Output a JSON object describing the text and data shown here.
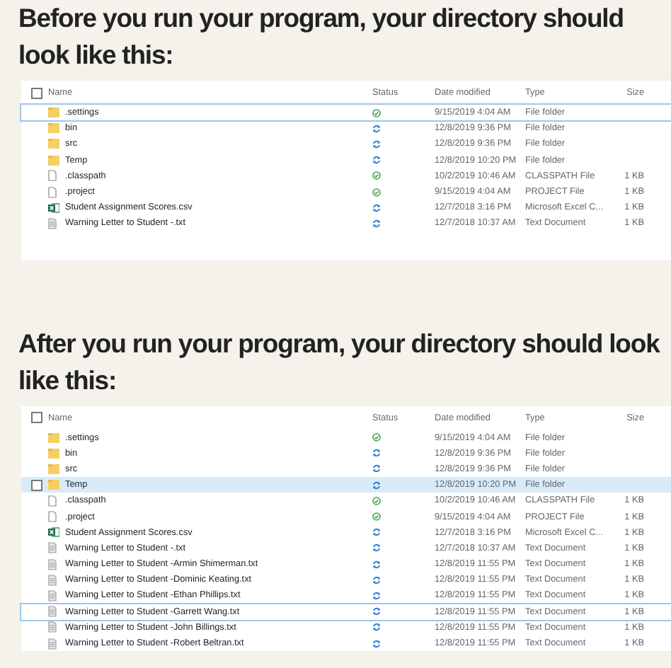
{
  "sections": [
    {
      "heading": "Before you run your program, your directory should look like this:",
      "explorer": {
        "select_all_checked": false,
        "columns": [
          "Name",
          "Status",
          "Date modified",
          "Type",
          "Size"
        ],
        "rows": [
          {
            "name": ".settings",
            "kind": "folder",
            "synced": true,
            "date": "9/15/2019 4:04 AM",
            "type": "File folder",
            "selected": false,
            "focused": true
          },
          {
            "name": "bin",
            "kind": "folder",
            "synced": false,
            "date": "12/8/2019 9:36 PM",
            "type": "File folder",
            "selected": false,
            "focused": false
          },
          {
            "name": "src",
            "kind": "folder",
            "synced": false,
            "date": "12/8/2019 9:36 PM",
            "type": "File folder",
            "selected": false,
            "focused": false
          },
          {
            "name": "Temp",
            "kind": "folder",
            "synced": false,
            "date": "12/8/2019 10:20 PM",
            "type": "File folder",
            "selected": false,
            "focused": false
          },
          {
            "name": ".classpath",
            "kind": "file",
            "synced": true,
            "date": "10/2/2019 10:46 AM",
            "type": "CLASSPATH File",
            "size": "1 KB",
            "selected": false,
            "focused": false
          },
          {
            "name": ".project",
            "kind": "file",
            "synced": true,
            "date": "9/15/2019 4:04 AM",
            "type": "PROJECT File",
            "size": "1 KB",
            "selected": false,
            "focused": false
          },
          {
            "name": "Student Assignment Scores.csv",
            "kind": "spreadsheet",
            "synced": false,
            "date": "12/7/2018 3:16 PM",
            "type": "Microsoft Excel C...",
            "size": "1 KB",
            "selected": false,
            "focused": false
          },
          {
            "name": "Warning Letter to Student -.txt",
            "kind": "text",
            "synced": false,
            "date": "12/7/2018 10:37 AM",
            "type": "Text Document",
            "size": "1 KB",
            "selected": false,
            "focused": false
          }
        ]
      }
    },
    {
      "heading": "After you run your program, your directory should look like this:",
      "explorer": {
        "select_all_checked": false,
        "columns": [
          "Name",
          "Status",
          "Date modified",
          "Type",
          "Size"
        ],
        "rows": [
          {
            "name": ".settings",
            "kind": "folder",
            "synced": true,
            "date": "9/15/2019 4:04 AM",
            "type": "File folder",
            "selected": false,
            "focused": false
          },
          {
            "name": "bin",
            "kind": "folder",
            "synced": false,
            "date": "12/8/2019 9:36 PM",
            "type": "File folder",
            "selected": false,
            "focused": false
          },
          {
            "name": "src",
            "kind": "folder",
            "synced": false,
            "date": "12/8/2019 9:36 PM",
            "type": "File folder",
            "selected": false,
            "focused": false
          },
          {
            "name": "Temp",
            "kind": "folder",
            "synced": false,
            "date": "12/8/2019 10:20 PM",
            "type": "File folder",
            "selected": true,
            "focused": false
          },
          {
            "name": ".classpath",
            "kind": "file",
            "synced": true,
            "date": "10/2/2019 10:46 AM",
            "type": "CLASSPATH File",
            "size": "1 KB",
            "selected": false,
            "focused": false
          },
          {
            "name": ".project",
            "kind": "file",
            "synced": true,
            "date": "9/15/2019 4:04 AM",
            "type": "PROJECT File",
            "size": "1 KB",
            "selected": false,
            "focused": false
          },
          {
            "name": "Student Assignment Scores.csv",
            "kind": "spreadsheet",
            "synced": false,
            "date": "12/7/2018 3:16 PM",
            "type": "Microsoft Excel C...",
            "size": "1 KB",
            "selected": false,
            "focused": false
          },
          {
            "name": "Warning Letter to Student -.txt",
            "kind": "text",
            "synced": false,
            "date": "12/7/2018 10:37 AM",
            "type": "Text Document",
            "size": "1 KB",
            "selected": false,
            "focused": false
          },
          {
            "name": "Warning Letter to Student -Armin Shimerman.txt",
            "kind": "text",
            "synced": false,
            "date": "12/8/2019 11:55 PM",
            "type": "Text Document",
            "size": "1 KB",
            "selected": false,
            "focused": false
          },
          {
            "name": "Warning Letter to Student -Dominic Keating.txt",
            "kind": "text",
            "synced": false,
            "date": "12/8/2019 11:55 PM",
            "type": "Text Document",
            "size": "1 KB",
            "selected": false,
            "focused": false
          },
          {
            "name": "Warning Letter to Student -Ethan Phillips.txt",
            "kind": "text",
            "synced": false,
            "date": "12/8/2019 11:55 PM",
            "type": "Text Document",
            "size": "1 KB",
            "selected": false,
            "focused": false
          },
          {
            "name": "Warning Letter to Student -Garrett Wang.txt",
            "kind": "text",
            "synced": false,
            "date": "12/8/2019 11:55 PM",
            "type": "Text Document",
            "size": "1 KB",
            "selected": false,
            "focused": true
          },
          {
            "name": "Warning Letter to Student -John Billings.txt",
            "kind": "text",
            "synced": false,
            "date": "12/8/2019 11:55 PM",
            "type": "Text Document",
            "size": "1 KB",
            "selected": false,
            "focused": false
          },
          {
            "name": "Warning Letter to Student -Robert Beltran.txt",
            "kind": "text",
            "synced": false,
            "date": "12/8/2019 11:55 PM",
            "type": "Text Document",
            "size": "1 KB",
            "selected": false,
            "focused": false
          }
        ]
      }
    }
  ]
}
